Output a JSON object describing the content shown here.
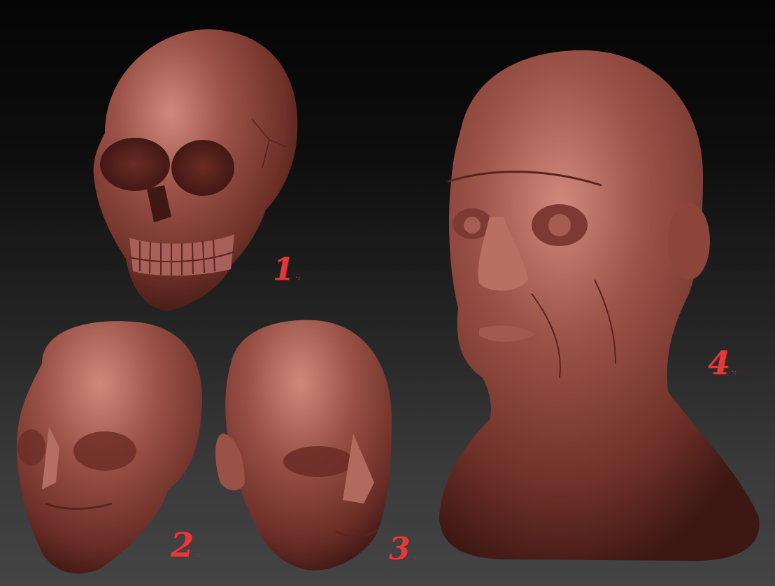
{
  "labels": {
    "n1": "1",
    "n2": "2",
    "n3": "3",
    "n4": "4",
    "dot": "·:"
  },
  "colors": {
    "clay_base": "#8f4840",
    "clay_light": "#c77a6d",
    "clay_shadow": "#4a1f1b",
    "label_red": "#e03a3a"
  },
  "sculptures": [
    {
      "id": "skull",
      "label": "1"
    },
    {
      "id": "planar-head",
      "label": "2"
    },
    {
      "id": "head-with-ear",
      "label": "3"
    },
    {
      "id": "old-man-bust",
      "label": "4"
    }
  ]
}
